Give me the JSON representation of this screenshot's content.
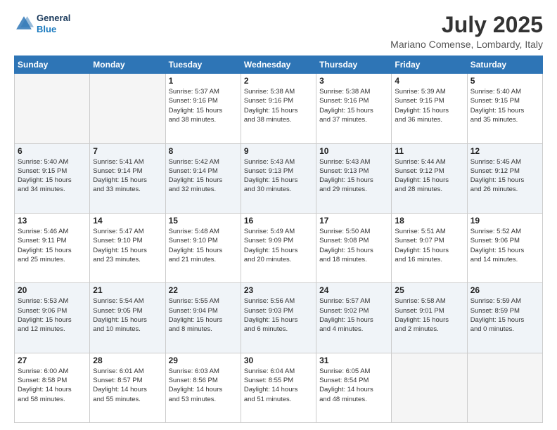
{
  "header": {
    "logo": {
      "line1": "General",
      "line2": "Blue"
    },
    "title": "July 2025",
    "location": "Mariano Comense, Lombardy, Italy"
  },
  "weekdays": [
    "Sunday",
    "Monday",
    "Tuesday",
    "Wednesday",
    "Thursday",
    "Friday",
    "Saturday"
  ],
  "weeks": [
    [
      {
        "day": "",
        "empty": true
      },
      {
        "day": "",
        "empty": true
      },
      {
        "day": "1",
        "sunrise": "Sunrise: 5:37 AM",
        "sunset": "Sunset: 9:16 PM",
        "daylight": "Daylight: 15 hours and 38 minutes."
      },
      {
        "day": "2",
        "sunrise": "Sunrise: 5:38 AM",
        "sunset": "Sunset: 9:16 PM",
        "daylight": "Daylight: 15 hours and 38 minutes."
      },
      {
        "day": "3",
        "sunrise": "Sunrise: 5:38 AM",
        "sunset": "Sunset: 9:16 PM",
        "daylight": "Daylight: 15 hours and 37 minutes."
      },
      {
        "day": "4",
        "sunrise": "Sunrise: 5:39 AM",
        "sunset": "Sunset: 9:15 PM",
        "daylight": "Daylight: 15 hours and 36 minutes."
      },
      {
        "day": "5",
        "sunrise": "Sunrise: 5:40 AM",
        "sunset": "Sunset: 9:15 PM",
        "daylight": "Daylight: 15 hours and 35 minutes."
      }
    ],
    [
      {
        "day": "6",
        "sunrise": "Sunrise: 5:40 AM",
        "sunset": "Sunset: 9:15 PM",
        "daylight": "Daylight: 15 hours and 34 minutes."
      },
      {
        "day": "7",
        "sunrise": "Sunrise: 5:41 AM",
        "sunset": "Sunset: 9:14 PM",
        "daylight": "Daylight: 15 hours and 33 minutes."
      },
      {
        "day": "8",
        "sunrise": "Sunrise: 5:42 AM",
        "sunset": "Sunset: 9:14 PM",
        "daylight": "Daylight: 15 hours and 32 minutes."
      },
      {
        "day": "9",
        "sunrise": "Sunrise: 5:43 AM",
        "sunset": "Sunset: 9:13 PM",
        "daylight": "Daylight: 15 hours and 30 minutes."
      },
      {
        "day": "10",
        "sunrise": "Sunrise: 5:43 AM",
        "sunset": "Sunset: 9:13 PM",
        "daylight": "Daylight: 15 hours and 29 minutes."
      },
      {
        "day": "11",
        "sunrise": "Sunrise: 5:44 AM",
        "sunset": "Sunset: 9:12 PM",
        "daylight": "Daylight: 15 hours and 28 minutes."
      },
      {
        "day": "12",
        "sunrise": "Sunrise: 5:45 AM",
        "sunset": "Sunset: 9:12 PM",
        "daylight": "Daylight: 15 hours and 26 minutes."
      }
    ],
    [
      {
        "day": "13",
        "sunrise": "Sunrise: 5:46 AM",
        "sunset": "Sunset: 9:11 PM",
        "daylight": "Daylight: 15 hours and 25 minutes."
      },
      {
        "day": "14",
        "sunrise": "Sunrise: 5:47 AM",
        "sunset": "Sunset: 9:10 PM",
        "daylight": "Daylight: 15 hours and 23 minutes."
      },
      {
        "day": "15",
        "sunrise": "Sunrise: 5:48 AM",
        "sunset": "Sunset: 9:10 PM",
        "daylight": "Daylight: 15 hours and 21 minutes."
      },
      {
        "day": "16",
        "sunrise": "Sunrise: 5:49 AM",
        "sunset": "Sunset: 9:09 PM",
        "daylight": "Daylight: 15 hours and 20 minutes."
      },
      {
        "day": "17",
        "sunrise": "Sunrise: 5:50 AM",
        "sunset": "Sunset: 9:08 PM",
        "daylight": "Daylight: 15 hours and 18 minutes."
      },
      {
        "day": "18",
        "sunrise": "Sunrise: 5:51 AM",
        "sunset": "Sunset: 9:07 PM",
        "daylight": "Daylight: 15 hours and 16 minutes."
      },
      {
        "day": "19",
        "sunrise": "Sunrise: 5:52 AM",
        "sunset": "Sunset: 9:06 PM",
        "daylight": "Daylight: 15 hours and 14 minutes."
      }
    ],
    [
      {
        "day": "20",
        "sunrise": "Sunrise: 5:53 AM",
        "sunset": "Sunset: 9:06 PM",
        "daylight": "Daylight: 15 hours and 12 minutes."
      },
      {
        "day": "21",
        "sunrise": "Sunrise: 5:54 AM",
        "sunset": "Sunset: 9:05 PM",
        "daylight": "Daylight: 15 hours and 10 minutes."
      },
      {
        "day": "22",
        "sunrise": "Sunrise: 5:55 AM",
        "sunset": "Sunset: 9:04 PM",
        "daylight": "Daylight: 15 hours and 8 minutes."
      },
      {
        "day": "23",
        "sunrise": "Sunrise: 5:56 AM",
        "sunset": "Sunset: 9:03 PM",
        "daylight": "Daylight: 15 hours and 6 minutes."
      },
      {
        "day": "24",
        "sunrise": "Sunrise: 5:57 AM",
        "sunset": "Sunset: 9:02 PM",
        "daylight": "Daylight: 15 hours and 4 minutes."
      },
      {
        "day": "25",
        "sunrise": "Sunrise: 5:58 AM",
        "sunset": "Sunset: 9:01 PM",
        "daylight": "Daylight: 15 hours and 2 minutes."
      },
      {
        "day": "26",
        "sunrise": "Sunrise: 5:59 AM",
        "sunset": "Sunset: 8:59 PM",
        "daylight": "Daylight: 15 hours and 0 minutes."
      }
    ],
    [
      {
        "day": "27",
        "sunrise": "Sunrise: 6:00 AM",
        "sunset": "Sunset: 8:58 PM",
        "daylight": "Daylight: 14 hours and 58 minutes."
      },
      {
        "day": "28",
        "sunrise": "Sunrise: 6:01 AM",
        "sunset": "Sunset: 8:57 PM",
        "daylight": "Daylight: 14 hours and 55 minutes."
      },
      {
        "day": "29",
        "sunrise": "Sunrise: 6:03 AM",
        "sunset": "Sunset: 8:56 PM",
        "daylight": "Daylight: 14 hours and 53 minutes."
      },
      {
        "day": "30",
        "sunrise": "Sunrise: 6:04 AM",
        "sunset": "Sunset: 8:55 PM",
        "daylight": "Daylight: 14 hours and 51 minutes."
      },
      {
        "day": "31",
        "sunrise": "Sunrise: 6:05 AM",
        "sunset": "Sunset: 8:54 PM",
        "daylight": "Daylight: 14 hours and 48 minutes."
      },
      {
        "day": "",
        "empty": true
      },
      {
        "day": "",
        "empty": true
      }
    ]
  ]
}
